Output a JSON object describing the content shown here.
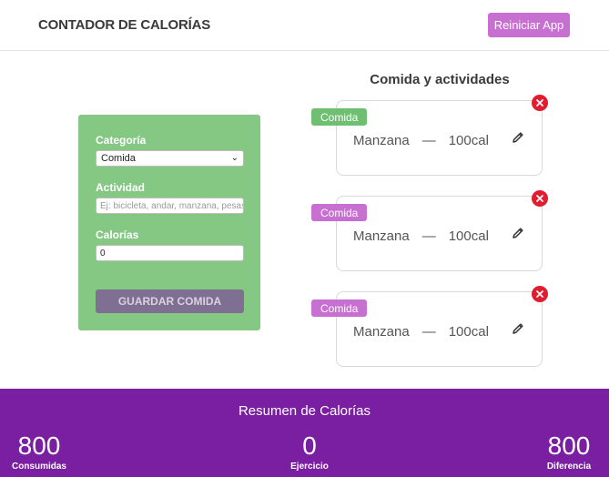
{
  "header": {
    "title": "CONTADOR DE CALORÍAS",
    "reset_label": "Reiniciar App",
    "reset_color": "#c86fd2"
  },
  "form": {
    "category_label": "Categoría",
    "category_value": "Comida",
    "category_options": [
      "Comida"
    ],
    "activity_label": "Actividad",
    "activity_placeholder": "Ej: bicicleta, andar, manzana, pesas",
    "activity_value": "",
    "calories_label": "Calorías",
    "calories_value": "0",
    "save_label": "GUARDAR COMIDA",
    "card_color": "#84c884",
    "save_color": "#7e6f93"
  },
  "list": {
    "title": "Comida y actividades",
    "items": [
      {
        "badge": "Comida",
        "name": "Manzana",
        "separator": "—",
        "calories": "100cal",
        "edit_icon": "pencil-icon",
        "delete_icon": "close-icon"
      },
      {
        "badge": "Comida",
        "name": "Manzana",
        "separator": "—",
        "calories": "100cal",
        "edit_icon": "pencil-icon",
        "delete_icon": "close-icon"
      },
      {
        "badge": "Comida",
        "name": "Manzana",
        "separator": "—",
        "calories": "100cal",
        "edit_icon": "pencil-icon",
        "delete_icon": "close-icon"
      }
    ],
    "badge_colors": [
      "#6fbf73",
      "#c86fd2",
      "#c86fd2"
    ],
    "delete_color": "#e11d2f"
  },
  "summary": {
    "title": "Resumen de Calorías",
    "consumed": {
      "value": "800",
      "label": "Consumidas"
    },
    "exercise": {
      "value": "0",
      "label": "Ejercicio"
    },
    "difference": {
      "value": "800",
      "label": "Diferencia"
    },
    "background_color": "#7b1fa2"
  }
}
